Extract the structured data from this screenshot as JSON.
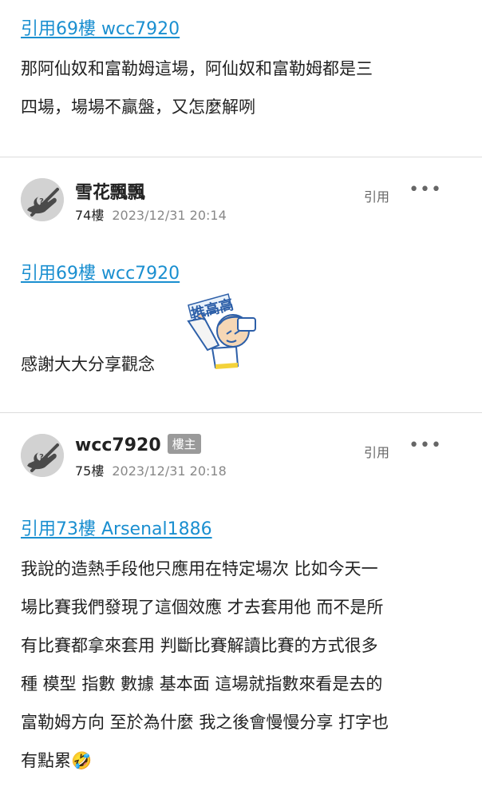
{
  "post1": {
    "quote_link": "引用69樓 wcc7920",
    "body_lines": [
      "那阿仙奴和富勒姆這場，阿仙奴和富勒姆都是三",
      "四場，場場不贏盤，又怎麼解咧"
    ]
  },
  "post2": {
    "username": "雪花飄飄",
    "floor": "74樓",
    "timestamp": "2023/12/31 20:14",
    "quote_label": "引用",
    "more_label": "•••",
    "quote_link": "引用69樓 wcc7920",
    "sticker_text": "推高高",
    "body": "感謝大大分享觀念"
  },
  "post3": {
    "username": "wcc7920",
    "badge": "樓主",
    "floor": "75樓",
    "timestamp": "2023/12/31 20:18",
    "quote_label": "引用",
    "more_label": "•••",
    "quote_link": "引用73樓 Arsenal1886",
    "body_lines": [
      "我說的造熱手段他只應用在特定場次 比如今天一",
      "場比賽我們發現了這個效應 才去套用他 而不是所",
      "有比賽都拿來套用 判斷比賽解讀比賽的方式很多",
      "種 模型 指數 數據 基本面 這場就指數來看是去的",
      "富勒姆方向 至於為什麼 我之後會慢慢分享 打字也",
      "有點累"
    ],
    "emoji": "🤣"
  },
  "colors": {
    "link": "#1a8fd0",
    "badge_bg": "#9a9a9a",
    "divider": "#dcdcdc",
    "avatar_bg": "#d2d2d2"
  },
  "icons": [
    "default-avatar-icon",
    "more-options-icon",
    "rofl-emoji-icon",
    "sticker-push-high"
  ]
}
